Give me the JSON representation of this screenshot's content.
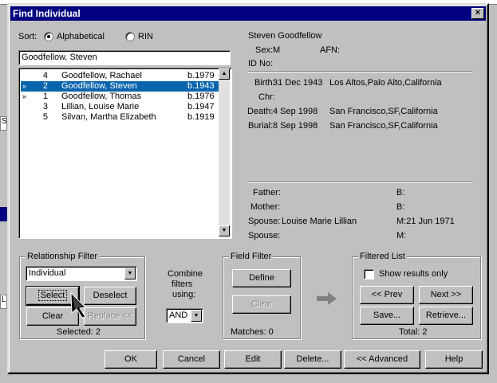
{
  "background": {
    "edge_labels": [
      "S",
      "L"
    ]
  },
  "dialog": {
    "title": "Find Individual",
    "close_glyph": "×"
  },
  "sort": {
    "label": "Sort:",
    "option_alpha": "Alphabetical",
    "option_rin": "RIN",
    "selected": "Alphabetical"
  },
  "search": {
    "value": "Goodfellow, Steven"
  },
  "list": {
    "rows": [
      {
        "mark": "",
        "num": "4",
        "name": "Goodfellow, Rachael",
        "birth": "b.1979",
        "selected": false
      },
      {
        "mark": "»",
        "num": "2",
        "name": "Goodfellow, Steven",
        "birth": "b.1943",
        "selected": true
      },
      {
        "mark": "»",
        "num": "1",
        "name": "Goodfellow, Thomas",
        "birth": "b.1976",
        "selected": false
      },
      {
        "mark": "",
        "num": "3",
        "name": "Lillian, Louise Marie",
        "birth": "b.1947",
        "selected": false
      },
      {
        "mark": "",
        "num": "5",
        "name": "Silvan, Martha Elizabeth",
        "birth": "b.1919",
        "selected": false
      }
    ]
  },
  "details": {
    "name": "Steven Goodfellow",
    "sex_label": "Sex:",
    "sex_value": "M",
    "afn_label": "AFN:",
    "afn_value": "",
    "id_label": "ID No:",
    "birth_label": "Birth:",
    "birth_date": "31 Dec 1943",
    "birth_place": "Los Altos,Palo Alto,California",
    "chr_label": "Chr:",
    "death_label": "Death:",
    "death_date": "4 Sep 1998",
    "death_place": "San Francisco,SF,California",
    "burial_label": "Burial:",
    "burial_date": "8 Sep 1998",
    "burial_place": "San Francisco,SF,California",
    "father_label": "Father:",
    "father_b": "B:",
    "mother_label": "Mother:",
    "mother_b": "B:",
    "spouse1_label": "Spouse:",
    "spouse1_value": "Louise Marie Lillian",
    "spouse1_m": "M:21 Jun 1971",
    "spouse2_label": "Spouse:",
    "spouse2_m": "M:"
  },
  "relationship_filter": {
    "legend": "Relationship Filter",
    "selected_option": "Individual",
    "select_label": "Select",
    "deselect_label": "Deselect",
    "clear_label": "Clear",
    "replace_label": "Replace <<",
    "selected_text": "Selected: 2"
  },
  "combine": {
    "label_line1": "Combine",
    "label_line2": "filters",
    "label_line3": "using:",
    "value": "AND"
  },
  "field_filter": {
    "legend": "Field Filter",
    "define_label": "Define",
    "clear_label": "Clear",
    "matches_text": "Matches: 0"
  },
  "filtered_list": {
    "legend": "Filtered List",
    "show_results_label": "Show results only",
    "show_results_checked": false,
    "prev_label": "<< Prev",
    "next_label": "Next >>",
    "save_label": "Save...",
    "retrieve_label": "Retrieve...",
    "total_text": "Total: 2"
  },
  "footer": {
    "ok_label": "OK",
    "cancel_label": "Cancel",
    "edit_label": "Edit",
    "delete_label": "Delete...",
    "advanced_label": "<< Advanced",
    "help_label": "Help"
  },
  "colors": {
    "titlebar": "#000080",
    "selection": "#0a64ad",
    "face": "#c0c0c0",
    "arrow": "#808080"
  }
}
